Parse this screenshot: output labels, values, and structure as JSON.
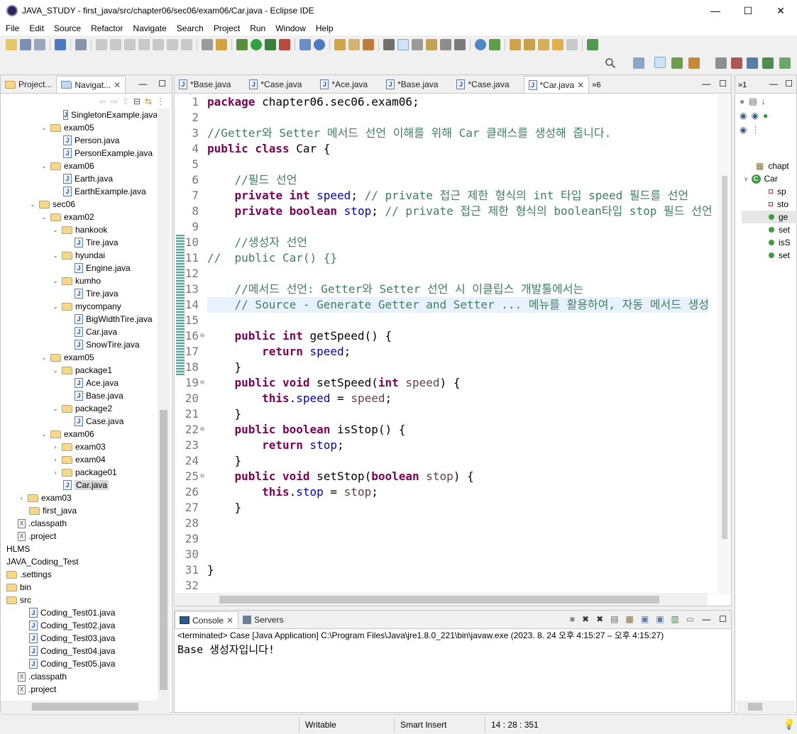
{
  "window": {
    "title": "JAVA_STUDY - first_java/src/chapter06/sec06/exam06/Car.java - Eclipse IDE",
    "min": "—",
    "max": "☐",
    "close": "✕"
  },
  "menu": [
    "File",
    "Edit",
    "Source",
    "Refactor",
    "Navigate",
    "Search",
    "Project",
    "Run",
    "Window",
    "Help"
  ],
  "left_tabs": [
    {
      "label": "Project..."
    },
    {
      "label": "Navigat..."
    }
  ],
  "editor_tabs": [
    {
      "label": "*Base.java"
    },
    {
      "label": "*Case.java"
    },
    {
      "label": "*Ace.java"
    },
    {
      "label": "*Base.java"
    },
    {
      "label": "*Case.java"
    },
    {
      "label": "*Car.java"
    }
  ],
  "editor_overflow": "»6",
  "outline_overflow": "»1",
  "tree": [
    {
      "label": "SingletonExample.java",
      "level": 4,
      "type": "java"
    },
    {
      "label": "exam05",
      "level": 2,
      "type": "folder",
      "arrow": "v"
    },
    {
      "label": "Person.java",
      "level": 4,
      "type": "java"
    },
    {
      "label": "PersonExample.java",
      "level": 4,
      "type": "java"
    },
    {
      "label": "exam06",
      "level": 2,
      "type": "folder",
      "arrow": "v"
    },
    {
      "label": "Earth.java",
      "level": 4,
      "type": "java"
    },
    {
      "label": "EarthExample.java",
      "level": 4,
      "type": "java"
    },
    {
      "label": "sec06",
      "level": 1,
      "type": "folder",
      "arrow": "v"
    },
    {
      "label": "exam02",
      "level": 2,
      "type": "folder",
      "arrow": "v"
    },
    {
      "label": "hankook",
      "level": 3,
      "type": "folder",
      "arrow": "v"
    },
    {
      "label": "Tire.java",
      "level": 5,
      "type": "java"
    },
    {
      "label": "hyundai",
      "level": 3,
      "type": "folder",
      "arrow": "v"
    },
    {
      "label": "Engine.java",
      "level": 5,
      "type": "java"
    },
    {
      "label": "kumho",
      "level": 3,
      "type": "folder",
      "arrow": "v"
    },
    {
      "label": "Tire.java",
      "level": 5,
      "type": "java"
    },
    {
      "label": "mycompany",
      "level": 3,
      "type": "folder",
      "arrow": "v"
    },
    {
      "label": "BigWidthTire.java",
      "level": 5,
      "type": "java"
    },
    {
      "label": "Car.java",
      "level": 5,
      "type": "java"
    },
    {
      "label": "SnowTire.java",
      "level": 5,
      "type": "java"
    },
    {
      "label": "exam05",
      "level": 2,
      "type": "folder",
      "arrow": "v"
    },
    {
      "label": "package1",
      "level": 3,
      "type": "folder",
      "arrow": "v"
    },
    {
      "label": "Ace.java",
      "level": 5,
      "type": "java"
    },
    {
      "label": "Base.java",
      "level": 5,
      "type": "java"
    },
    {
      "label": "package2",
      "level": 3,
      "type": "folder",
      "arrow": "v"
    },
    {
      "label": "Case.java",
      "level": 5,
      "type": "java"
    },
    {
      "label": "exam06",
      "level": 2,
      "type": "folder",
      "arrow": "v"
    },
    {
      "label": "exam03",
      "level": 3,
      "type": "folder",
      "arrow": ">"
    },
    {
      "label": "exam04",
      "level": 3,
      "type": "folder",
      "arrow": ">"
    },
    {
      "label": "package01",
      "level": 3,
      "type": "folder",
      "arrow": ">"
    },
    {
      "label": "Car.java",
      "level": 4,
      "type": "java",
      "selected": true
    },
    {
      "label": "exam03",
      "level": 0,
      "type": "folder",
      "arrow": ">"
    },
    {
      "label": "first_java",
      "level": 1,
      "type": "folder"
    },
    {
      "label": ".classpath",
      "level": 0,
      "type": "x"
    },
    {
      "label": ".project",
      "level": 0,
      "type": "x"
    },
    {
      "label": "HLMS",
      "level": -1,
      "type": "none"
    },
    {
      "label": "JAVA_Coding_Test",
      "level": -1,
      "type": "none"
    },
    {
      "label": ".settings",
      "level": -1,
      "type": "folder"
    },
    {
      "label": "bin",
      "level": -1,
      "type": "folder"
    },
    {
      "label": "src",
      "level": -1,
      "type": "folder"
    },
    {
      "label": "Coding_Test01.java",
      "level": 1,
      "type": "java"
    },
    {
      "label": "Coding_Test02.java",
      "level": 1,
      "type": "java"
    },
    {
      "label": "Coding_Test03.java",
      "level": 1,
      "type": "java"
    },
    {
      "label": "Coding_Test04.java",
      "level": 1,
      "type": "java"
    },
    {
      "label": "Coding_Test05.java",
      "level": 1,
      "type": "java"
    },
    {
      "label": ".classpath",
      "level": 0,
      "type": "x"
    },
    {
      "label": ".project",
      "level": 0,
      "type": "x"
    }
  ],
  "code_lines": [
    {
      "n": "1",
      "tokens": [
        [
          "kw",
          "package"
        ],
        [
          "nm",
          " chapter06.sec06.exam06;"
        ]
      ]
    },
    {
      "n": "2",
      "tokens": []
    },
    {
      "n": "3",
      "tokens": [
        [
          "cm",
          "//Getter와 Setter 메서드 선언 이해를 위해 Car 클래스를 생성해 줍니다."
        ]
      ]
    },
    {
      "n": "4",
      "tokens": [
        [
          "kw",
          "public class"
        ],
        [
          "nm",
          " Car {"
        ]
      ]
    },
    {
      "n": "5",
      "tokens": []
    },
    {
      "n": "6",
      "tokens": [
        [
          "nm",
          "    "
        ],
        [
          "cm",
          "//필드 선언"
        ]
      ]
    },
    {
      "n": "7",
      "tokens": [
        [
          "nm",
          "    "
        ],
        [
          "kw",
          "private int"
        ],
        [
          "nm",
          " "
        ],
        [
          "fd",
          "speed"
        ],
        [
          "nm",
          "; "
        ],
        [
          "cm",
          "// private 접근 제한 형식의 int 타입 speed 필드를 선언"
        ]
      ]
    },
    {
      "n": "8",
      "tokens": [
        [
          "nm",
          "    "
        ],
        [
          "kw",
          "private boolean"
        ],
        [
          "nm",
          " "
        ],
        [
          "fd",
          "stop"
        ],
        [
          "nm",
          "; "
        ],
        [
          "cm",
          "// private 접근 제한 형식의 boolean타입 stop 필드 선언"
        ]
      ]
    },
    {
      "n": "9",
      "tokens": []
    },
    {
      "n": "10",
      "tokens": [
        [
          "nm",
          "    "
        ],
        [
          "cm",
          "//생성자 선언"
        ]
      ]
    },
    {
      "n": "11",
      "tokens": [
        [
          "cm",
          "//  public Car() {}"
        ]
      ]
    },
    {
      "n": "12",
      "tokens": []
    },
    {
      "n": "13",
      "tokens": [
        [
          "nm",
          "    "
        ],
        [
          "cm",
          "//메서드 선언: Getter와 Setter 선언 시 이클립스 개발툴에서는"
        ]
      ]
    },
    {
      "n": "14",
      "tokens": [
        [
          "nm",
          "    "
        ],
        [
          "cm",
          "// Source - Generate Getter and Setter ... 메뉴를 활용하여, 자동 메서드 생성"
        ]
      ]
    },
    {
      "n": "15",
      "tokens": []
    },
    {
      "n": "16",
      "tokens": [
        [
          "nm",
          "    "
        ],
        [
          "kw",
          "public int"
        ],
        [
          "nm",
          " getSpeed() {"
        ]
      ]
    },
    {
      "n": "17",
      "tokens": [
        [
          "nm",
          "        "
        ],
        [
          "kw",
          "return"
        ],
        [
          "nm",
          " "
        ],
        [
          "fd",
          "speed"
        ],
        [
          "nm",
          ";"
        ]
      ]
    },
    {
      "n": "18",
      "tokens": [
        [
          "nm",
          "    }"
        ]
      ]
    },
    {
      "n": "19",
      "tokens": [
        [
          "nm",
          "    "
        ],
        [
          "kw",
          "public void"
        ],
        [
          "nm",
          " setSpeed("
        ],
        [
          "kw",
          "int"
        ],
        [
          "nm",
          " "
        ],
        [
          "vr",
          "speed"
        ],
        [
          "nm",
          ") {"
        ]
      ]
    },
    {
      "n": "20",
      "tokens": [
        [
          "nm",
          "        "
        ],
        [
          "kw",
          "this"
        ],
        [
          "nm",
          "."
        ],
        [
          "fd",
          "speed"
        ],
        [
          "nm",
          " = "
        ],
        [
          "vr",
          "speed"
        ],
        [
          "nm",
          ";"
        ]
      ]
    },
    {
      "n": "21",
      "tokens": [
        [
          "nm",
          "    }"
        ]
      ]
    },
    {
      "n": "22",
      "tokens": [
        [
          "nm",
          "    "
        ],
        [
          "kw",
          "public boolean"
        ],
        [
          "nm",
          " isStop() {"
        ]
      ]
    },
    {
      "n": "23",
      "tokens": [
        [
          "nm",
          "        "
        ],
        [
          "kw",
          "return"
        ],
        [
          "nm",
          " "
        ],
        [
          "fd",
          "stop"
        ],
        [
          "nm",
          ";"
        ]
      ]
    },
    {
      "n": "24",
      "tokens": [
        [
          "nm",
          "    }"
        ]
      ]
    },
    {
      "n": "25",
      "tokens": [
        [
          "nm",
          "    "
        ],
        [
          "kw",
          "public void"
        ],
        [
          "nm",
          " setStop("
        ],
        [
          "kw",
          "boolean"
        ],
        [
          "nm",
          " "
        ],
        [
          "vr",
          "stop"
        ],
        [
          "nm",
          ") {"
        ]
      ]
    },
    {
      "n": "26",
      "tokens": [
        [
          "nm",
          "        "
        ],
        [
          "kw",
          "this"
        ],
        [
          "nm",
          "."
        ],
        [
          "fd",
          "stop"
        ],
        [
          "nm",
          " = "
        ],
        [
          "vr",
          "stop"
        ],
        [
          "nm",
          ";"
        ]
      ]
    },
    {
      "n": "27",
      "tokens": [
        [
          "nm",
          "    }"
        ]
      ]
    },
    {
      "n": "28",
      "tokens": []
    },
    {
      "n": "29",
      "tokens": []
    },
    {
      "n": "30",
      "tokens": []
    },
    {
      "n": "31",
      "tokens": [
        [
          "nm",
          "}"
        ]
      ]
    },
    {
      "n": "32",
      "tokens": []
    }
  ],
  "fold_markers": [
    "16",
    "19",
    "22",
    "25"
  ],
  "console": {
    "tab_console": "Console",
    "tab_servers": "Servers",
    "terminated": "<terminated> Case [Java Application] C:\\Program Files\\Java\\jre1.8.0_221\\bin\\javaw.exe  (2023. 8. 24 오후 4:15:27 – 오후 4:15:27)",
    "output": "Base 생성자입니다!"
  },
  "outline": {
    "package_label": "chapt",
    "class_label": "Car",
    "members": [
      "sp",
      "sto",
      "ge",
      "set",
      "isS",
      "set"
    ]
  },
  "status": {
    "writable": "Writable",
    "insert_mode": "Smart Insert",
    "position": "14 : 28 : 351"
  }
}
